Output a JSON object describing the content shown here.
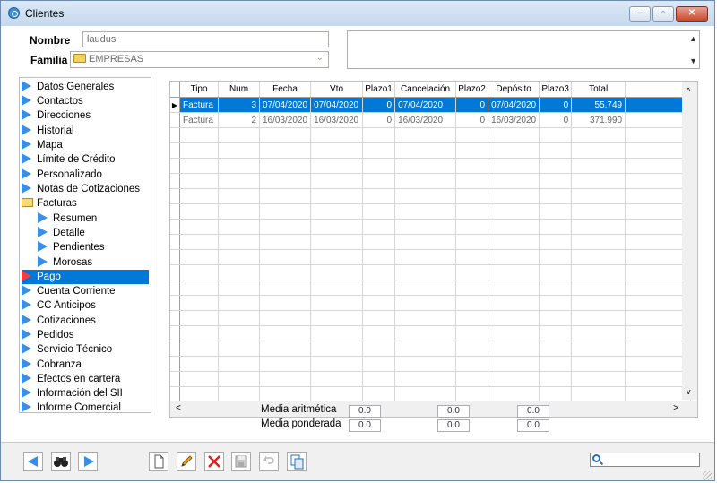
{
  "window": {
    "title": "Clientes"
  },
  "header": {
    "nombre_label": "Nombre",
    "nombre_value": "laudus",
    "familia_label": "Familia",
    "familia_value": "EMPRESAS"
  },
  "nav": {
    "items": [
      {
        "label": "Datos Generales"
      },
      {
        "label": "Contactos"
      },
      {
        "label": "Direcciones"
      },
      {
        "label": "Historial"
      },
      {
        "label": "Mapa"
      },
      {
        "label": "Límite de Crédito"
      },
      {
        "label": "Personalizado"
      },
      {
        "label": "Notas de Cotizaciones"
      },
      {
        "label": "Facturas"
      },
      {
        "label": "Resumen"
      },
      {
        "label": "Detalle"
      },
      {
        "label": "Pendientes"
      },
      {
        "label": "Morosas"
      },
      {
        "label": "Pago"
      },
      {
        "label": "Cuenta Corriente"
      },
      {
        "label": "CC Anticipos"
      },
      {
        "label": "Cotizaciones"
      },
      {
        "label": "Pedidos"
      },
      {
        "label": "Servicio Técnico"
      },
      {
        "label": "Cobranza"
      },
      {
        "label": "Efectos en cartera"
      },
      {
        "label": "Información del SII"
      },
      {
        "label": "Informe Comercial"
      }
    ]
  },
  "table": {
    "columns": [
      "Tipo",
      "Num",
      "Fecha",
      "Vto",
      "Plazo1",
      "Cancelación",
      "Plazo2",
      "Depósito",
      "Plazo3",
      "Total"
    ],
    "rows": [
      {
        "tipo": "Factura",
        "num": "3",
        "fecha": "07/04/2020",
        "vto": "07/04/2020",
        "plazo1": "0",
        "cancelacion": "07/04/2020",
        "plazo2": "0",
        "deposito": "07/04/2020",
        "plazo3": "0",
        "total": "55.749"
      },
      {
        "tipo": "Factura",
        "num": "2",
        "fecha": "16/03/2020",
        "vto": "16/03/2020",
        "plazo1": "0",
        "cancelacion": "16/03/2020",
        "plazo2": "0",
        "deposito": "16/03/2020",
        "plazo3": "0",
        "total": "371.990"
      }
    ]
  },
  "stats": {
    "media_aritmetica_label": "Media aritmética",
    "media_ponderada_label": "Media ponderada",
    "aritmetica": [
      "0.0",
      "0.0",
      "0.0"
    ],
    "ponderada": [
      "0.0",
      "0.0",
      "0.0"
    ]
  },
  "colors": {
    "accent": "#0078d7",
    "nav_arrow": "#3a8ee6",
    "selected_arrow": "#ff3a3a"
  },
  "icons": [
    "prev-arrow-icon",
    "binoculars-icon",
    "next-arrow-icon",
    "new-document-icon",
    "edit-pencil-icon",
    "delete-x-icon",
    "save-disk-icon",
    "undo-icon",
    "copy-icon",
    "search-icon"
  ]
}
